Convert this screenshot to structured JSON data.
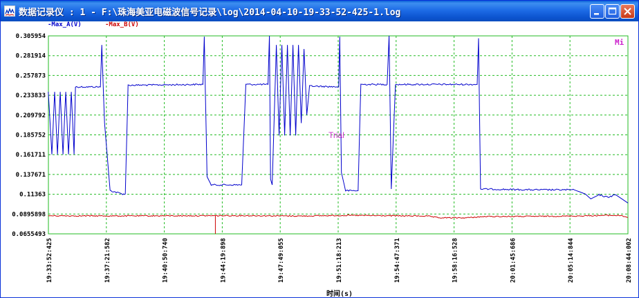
{
  "window": {
    "title": "数据记录仪 : 1 - F:\\珠海美亚电磁波信号记录\\log\\2014-04-10-19-33-52-425-1.log"
  },
  "titlebar_buttons": {
    "minimize": "minimize-icon",
    "maximize": "maximize-icon",
    "close": "close-icon"
  },
  "legend": {
    "a_label": "-Max_A(V)",
    "b_label": "-Max_B(V)",
    "a_color": "#0000CC",
    "b_color": "#CC0000"
  },
  "overlay": {
    "watermark": "Trial",
    "corner_mark": "Mi"
  },
  "colors": {
    "grid": "#22BB22",
    "frame": "#22BB22",
    "series_a": "#0000CC",
    "series_b": "#CC0000"
  },
  "chart_data": {
    "type": "line",
    "xlabel": "时间(s)",
    "ylabel": "",
    "y_ticks": [
      "0.305954",
      "0.281914",
      "0.257873",
      "0.233833",
      "0.209792",
      "0.185752",
      "0.161711",
      "0.137671",
      "0.11363",
      "0.0895898",
      "0.0655493"
    ],
    "ylim": [
      0.0655493,
      0.305954
    ],
    "x_ticks": [
      "19:33:52:425",
      "19:37:21:582",
      "19:40:50:740",
      "19:44:19:898",
      "19:47:49:055",
      "19:51:18:213",
      "19:54:47:371",
      "19:58:16:528",
      "20:01:45:686",
      "20:05:14:844",
      "20:08:44:002"
    ],
    "grid": true,
    "legend_position": "top-left",
    "series": [
      {
        "name": "Max_A(V)",
        "color": "#0000CC",
        "points": [
          [
            "19:33:52",
            0.238
          ],
          [
            "19:34:05",
            0.162
          ],
          [
            "19:34:15",
            0.238
          ],
          [
            "19:34:25",
            0.162
          ],
          [
            "19:34:35",
            0.238
          ],
          [
            "19:34:45",
            0.162
          ],
          [
            "19:34:55",
            0.238
          ],
          [
            "19:35:05",
            0.162
          ],
          [
            "19:35:15",
            0.238
          ],
          [
            "19:35:25",
            0.162
          ],
          [
            "19:35:30",
            0.244
          ],
          [
            "19:37:00",
            0.244
          ],
          [
            "19:37:05",
            0.295
          ],
          [
            "19:37:15",
            0.2
          ],
          [
            "19:37:35",
            0.118
          ],
          [
            "19:38:20",
            0.114
          ],
          [
            "19:38:30",
            0.114
          ],
          [
            "19:38:40",
            0.246
          ],
          [
            "19:43:10",
            0.247
          ],
          [
            "19:43:15",
            0.305
          ],
          [
            "19:43:25",
            0.135
          ],
          [
            "19:43:40",
            0.125
          ],
          [
            "19:45:30",
            0.125
          ],
          [
            "19:45:45",
            0.247
          ],
          [
            "19:47:05",
            0.247
          ],
          [
            "19:47:10",
            0.306
          ],
          [
            "19:47:14",
            0.132
          ],
          [
            "19:47:20",
            0.125
          ],
          [
            "19:47:35",
            0.295
          ],
          [
            "19:47:45",
            0.185
          ],
          [
            "19:47:55",
            0.295
          ],
          [
            "19:48:05",
            0.185
          ],
          [
            "19:48:15",
            0.295
          ],
          [
            "19:48:25",
            0.185
          ],
          [
            "19:48:35",
            0.295
          ],
          [
            "19:48:45",
            0.185
          ],
          [
            "19:48:55",
            0.295
          ],
          [
            "19:49:05",
            0.2
          ],
          [
            "19:49:15",
            0.29
          ],
          [
            "19:49:25",
            0.21
          ],
          [
            "19:49:35",
            0.245
          ],
          [
            "19:51:20",
            0.244
          ],
          [
            "19:51:24",
            0.305
          ],
          [
            "19:51:30",
            0.14
          ],
          [
            "19:51:45",
            0.118
          ],
          [
            "19:52:30",
            0.118
          ],
          [
            "19:52:40",
            0.247
          ],
          [
            "19:54:15",
            0.247
          ],
          [
            "19:54:22",
            0.306
          ],
          [
            "19:54:30",
            0.12
          ],
          [
            "19:54:45",
            0.247
          ],
          [
            "19:59:40",
            0.247
          ],
          [
            "19:59:45",
            0.303
          ],
          [
            "19:59:52",
            0.12
          ],
          [
            "20:03:00",
            0.119
          ],
          [
            "20:05:30",
            0.119
          ],
          [
            "20:06:10",
            0.114
          ],
          [
            "20:06:30",
            0.108
          ],
          [
            "20:07:00",
            0.113
          ],
          [
            "20:07:30",
            0.11
          ],
          [
            "20:08:00",
            0.113
          ],
          [
            "20:08:44",
            0.103
          ]
        ]
      },
      {
        "name": "Max_B(V)",
        "color": "#CC0000",
        "points": [
          [
            "19:33:52",
            0.0875
          ],
          [
            "19:38:00",
            0.0873
          ],
          [
            "19:42:00",
            0.0875
          ],
          [
            "19:45:30",
            0.0877
          ],
          [
            "19:49:00",
            0.0872
          ],
          [
            "19:52:00",
            0.088
          ],
          [
            "19:55:00",
            0.0874
          ],
          [
            "19:56:40",
            0.0872
          ],
          [
            "19:57:20",
            0.085
          ],
          [
            "19:59:00",
            0.085
          ],
          [
            "20:00:10",
            0.0866
          ],
          [
            "20:03:00",
            0.0868
          ],
          [
            "20:05:30",
            0.0872
          ],
          [
            "20:07:30",
            0.088
          ],
          [
            "20:08:20",
            0.0878
          ],
          [
            "20:08:44",
            0.0855
          ]
        ],
        "spike_at": "19:43:55",
        "spike_min": 0.0655
      }
    ]
  }
}
